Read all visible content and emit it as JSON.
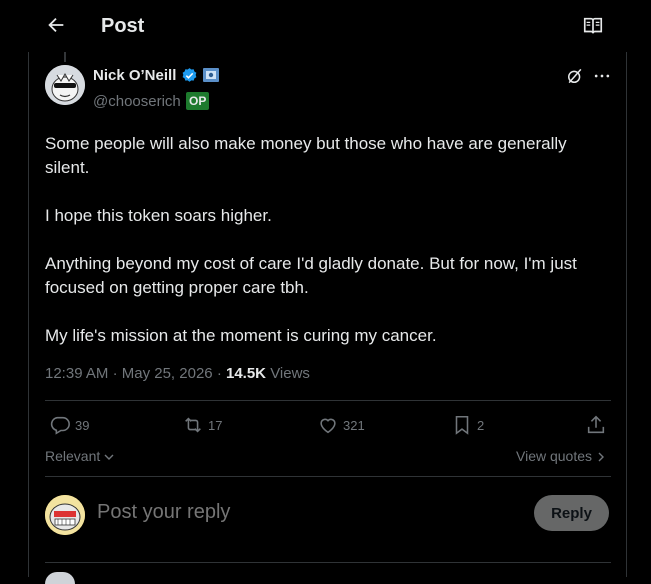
{
  "header": {
    "title": "Post",
    "back_icon": "arrow-left-icon",
    "reader_icon": "book-open-icon"
  },
  "author": {
    "name": "Nick O’Neill",
    "handle": "@chooserich",
    "op_badge": "OP",
    "verified_color": "#1d9bf0"
  },
  "post": {
    "paragraphs": [
      "Some people will also make money but those who have are generally silent.",
      "I hope this token soars higher.",
      "Anything beyond my cost of care I'd gladly donate. But for now, I'm just focused on getting proper care tbh.",
      "My life's mission at the moment is curing my cancer."
    ],
    "time": "12:39 AM",
    "date": "May 25, 2026",
    "views_count": "14.5K",
    "views_label": "Views"
  },
  "actions": {
    "replies": "39",
    "reposts": "17",
    "likes": "321",
    "bookmarks": "2"
  },
  "sort": {
    "label": "Relevant"
  },
  "quotes": {
    "label": "View quotes"
  },
  "composer": {
    "placeholder": "Post your reply",
    "button": "Reply"
  }
}
